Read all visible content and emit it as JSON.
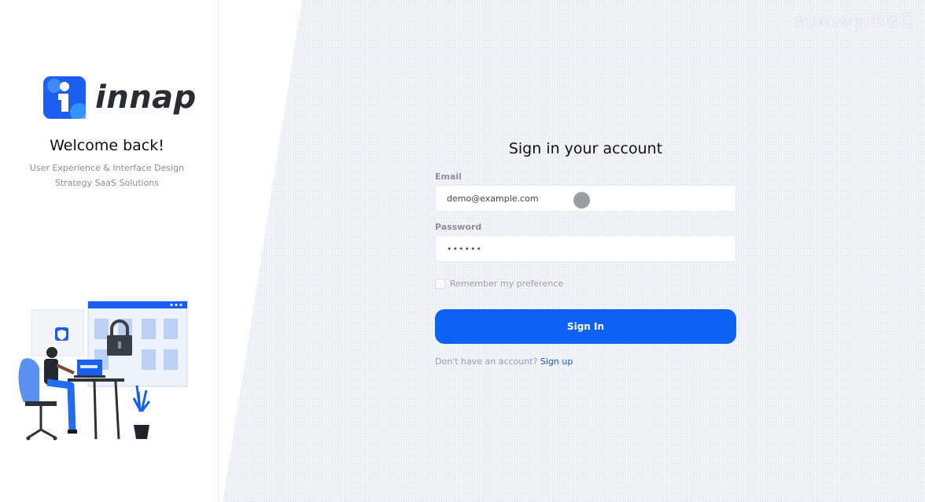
{
  "brand": {
    "name": "innap",
    "logo_icon": "innap-logo-icon"
  },
  "welcome": {
    "title": "Welcome back!",
    "tagline_line1": "User Experience & Interface Design",
    "tagline_line2": "Strategy SaaS Solutions"
  },
  "watermark": "ApowerREC",
  "form": {
    "title": "Sign in your account",
    "email_label": "Email",
    "email_value": "demo@example.com",
    "password_label": "Password",
    "password_value": "••••••",
    "remember_label": "Remember my preference",
    "remember_checked": false,
    "submit_label": "Sign In",
    "signup_prompt": "Don't have an account?",
    "signup_link": "Sign up"
  },
  "colors": {
    "accent": "#0d62f5",
    "link": "#1455d6",
    "background_pattern": "#eef1f6"
  }
}
